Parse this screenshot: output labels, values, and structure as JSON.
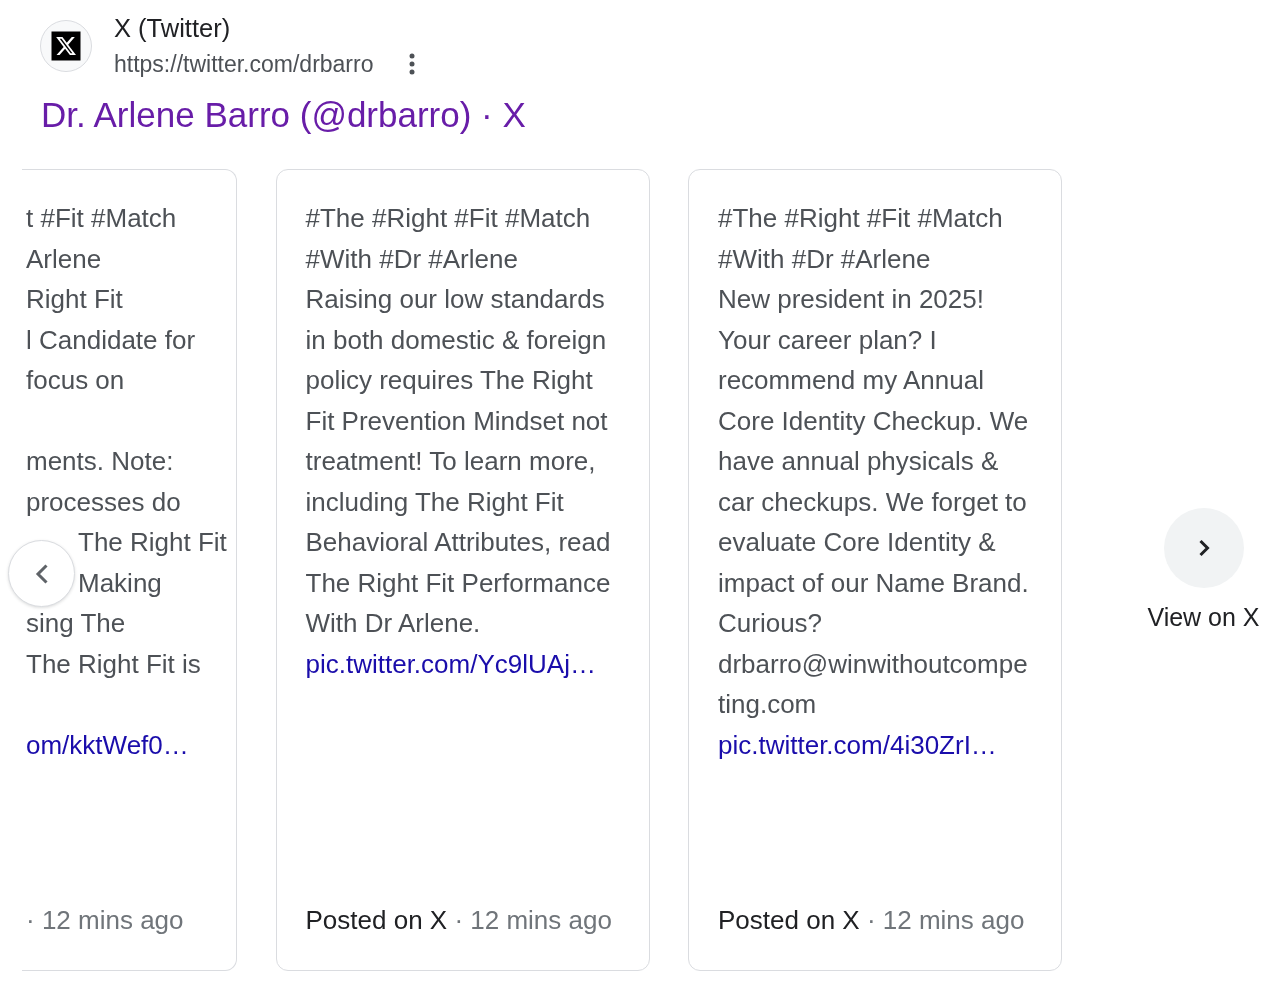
{
  "result": {
    "site_name": "X (Twitter)",
    "url": "https://twitter.com/drbarro",
    "title": "Dr. Arlene Barro (@drbarro) · X"
  },
  "carousel": {
    "posts": [
      {
        "kind": "partial",
        "paragraphs": [
          {
            "lines": [
              "t #Fit #Match",
              "Arlene",
              "Right Fit",
              "l Candidate for",
              "focus on"
            ]
          },
          {
            "lines": [
              "ments. Note:",
              "processes do",
              "The Right Fit",
              "Making",
              "sing The",
              "The Right Fit is"
            ]
          },
          {
            "link": "om/kktWef0…"
          }
        ],
        "meta": "· 12 mins ago"
      },
      {
        "kind": "full",
        "paragraphs": [
          {
            "lines": [
              "#The #Right #Fit #Match",
              "#With #Dr #Arlene",
              "Raising our low standards",
              "in both domestic & foreign",
              "policy requires The Right",
              "Fit Prevention Mindset not",
              "treatment! To learn more,",
              "including The Right Fit",
              "Behavioral Attributes, read",
              "The Right Fit Performance",
              "With Dr Arlene."
            ],
            "link": "pic.twitter.com/Yc9lUAj…"
          }
        ],
        "source": "Posted on X",
        "meta": "· 12 mins ago"
      },
      {
        "kind": "full",
        "paragraphs": [
          {
            "lines": [
              "#The #Right #Fit #Match",
              "#With #Dr #Arlene",
              "New president in 2025!",
              "Your career plan? I",
              "recommend my Annual",
              "Core Identity Checkup. We",
              "have annual physicals &",
              "car checkups. We forget to",
              "evaluate Core Identity &",
              "impact of our Name Brand.",
              "Curious?",
              "drbarro@winwithoutcompe",
              "ting.com"
            ],
            "link": "pic.twitter.com/4i30ZrI…"
          }
        ],
        "source": "Posted on X",
        "meta": "· 12 mins ago"
      }
    ],
    "view_more": "View on X"
  }
}
